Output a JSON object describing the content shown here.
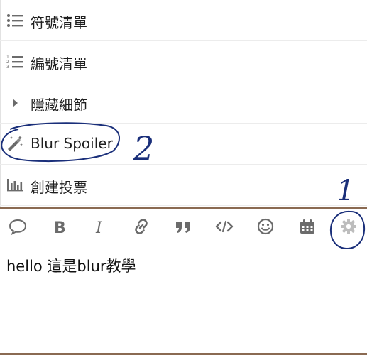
{
  "menu": {
    "items": [
      {
        "label": "符號清單",
        "icon": "bullet-list-icon"
      },
      {
        "label": "編號清單",
        "icon": "numbered-list-icon"
      },
      {
        "label": "隱藏細節",
        "icon": "caret-right-icon"
      },
      {
        "label": "Blur Spoiler",
        "icon": "magic-wand-icon"
      },
      {
        "label": "創建投票",
        "icon": "bar-chart-icon"
      }
    ]
  },
  "toolbar": {
    "buttons": [
      {
        "name": "quote-reply-icon"
      },
      {
        "name": "bold-icon"
      },
      {
        "name": "italic-icon"
      },
      {
        "name": "link-icon"
      },
      {
        "name": "blockquote-icon"
      },
      {
        "name": "code-icon"
      },
      {
        "name": "emoji-icon"
      },
      {
        "name": "calendar-icon"
      },
      {
        "name": "gear-icon"
      }
    ]
  },
  "editor": {
    "text": "hello 這是blur教學"
  },
  "annotations": {
    "step1": "1",
    "step2": "2",
    "ink_color": "#1a2f7a"
  },
  "colors": {
    "icon": "#6b6b6b",
    "gear": "#bdbdbd",
    "divider": "#8a6a52"
  }
}
